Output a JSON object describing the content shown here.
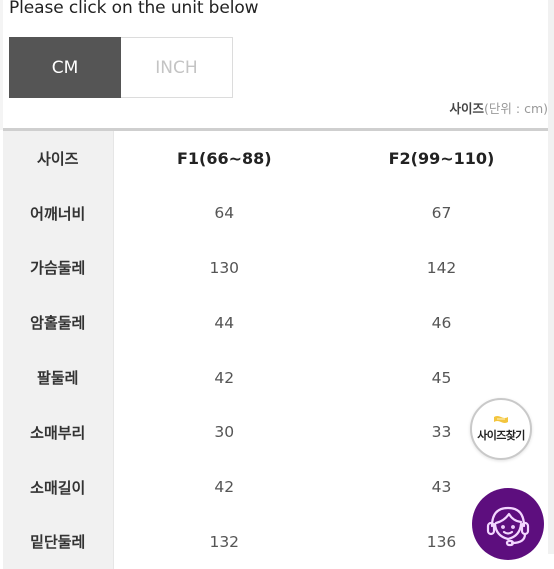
{
  "instruction": "Please click on the unit below",
  "unit_toggle": {
    "options": [
      {
        "label": "CM",
        "active": true
      },
      {
        "label": "INCH",
        "active": false
      }
    ]
  },
  "unit_caption": {
    "bold": "사이즈",
    "rest": "(단위 : cm)"
  },
  "table": {
    "header": [
      "사이즈",
      "F1(66~88)",
      "F2(99~110)"
    ],
    "rows": [
      {
        "label": "어깨너비",
        "values": [
          "64",
          "67"
        ]
      },
      {
        "label": "가슴둘레",
        "values": [
          "130",
          "142"
        ]
      },
      {
        "label": "암홀둘레",
        "values": [
          "44",
          "46"
        ]
      },
      {
        "label": "팔둘레",
        "values": [
          "42",
          "45"
        ]
      },
      {
        "label": "소매부리",
        "values": [
          "30",
          "33"
        ]
      },
      {
        "label": "소매길이",
        "values": [
          "42",
          "43"
        ]
      },
      {
        "label": "밑단둘레",
        "values": [
          "132",
          "136"
        ]
      }
    ]
  },
  "floating": {
    "size_finder_label": "사이즈찾기",
    "size_finder_icon": "flag-icon",
    "support_icon": "headset-agent-icon",
    "support_color": "#5d0e7e"
  },
  "colors": {
    "active_unit_bg": "#555555",
    "label_col_bg": "#f1f1f1"
  }
}
